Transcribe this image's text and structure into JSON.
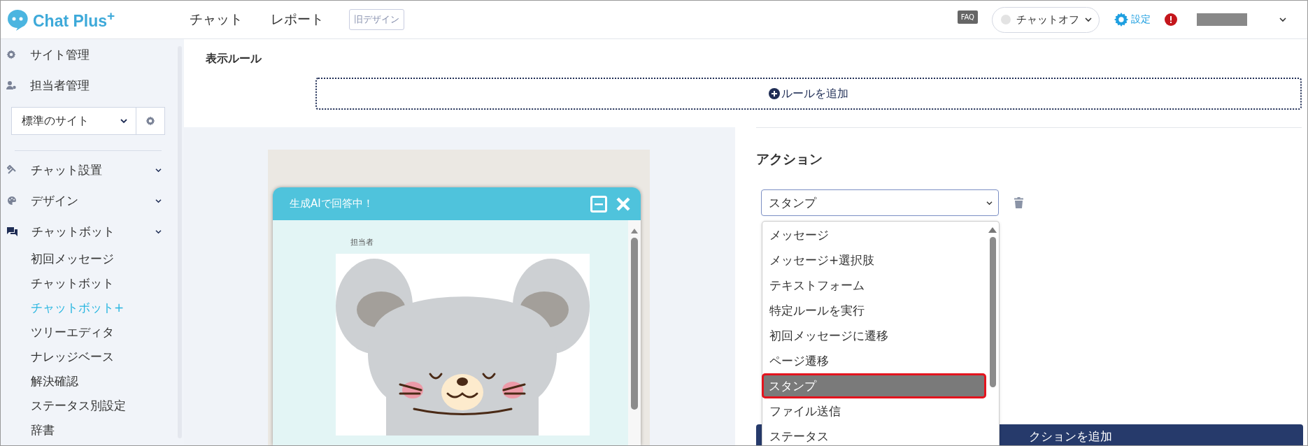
{
  "header": {
    "logo": "Chat Plus$^{+}$",
    "nav": [
      {
        "label": "チャット"
      },
      {
        "label": "レポート"
      }
    ],
    "old_design_button": "旧デザイン",
    "faq_label": "FAQ",
    "chat_status": {
      "label": "チャットオフ",
      "on": false
    },
    "settings": "設定"
  },
  "sidebar": {
    "top_items": [
      {
        "label": "サイト管理",
        "kind": "gear"
      },
      {
        "label": "担当者管理",
        "kind": "person"
      }
    ],
    "site_select": "標準のサイト",
    "sections": [
      {
        "label": "チャット設置",
        "kind": "tools"
      },
      {
        "label": "デザイン",
        "kind": "palette"
      },
      {
        "label": "チャットボット",
        "kind": "chat",
        "children": [
          {
            "label": "初回メッセージ",
            "selected": false
          },
          {
            "label": "チャットボット",
            "selected": false
          },
          {
            "label": "チャットボット+",
            "selected": true
          },
          {
            "label": "ツリーエディタ",
            "selected": false
          },
          {
            "label": "ナレッジベース",
            "selected": false
          },
          {
            "label": "解決確認",
            "selected": false
          },
          {
            "label": "ステータス別設定",
            "selected": false
          },
          {
            "label": "辞書",
            "selected": false
          }
        ]
      }
    ]
  },
  "display_rule": {
    "title": "表示ルール",
    "add_rule": "ルールを追加"
  },
  "preview": {
    "chat_title": "生成AIで回答中！",
    "agent_label": "担当者"
  },
  "action": {
    "title": "アクション",
    "select_value": "スタンプ",
    "add_action": "クションを追加",
    "options": [
      {
        "label": "メッセージ",
        "selected": false
      },
      {
        "label": "メッセージ+選択肢",
        "selected": false
      },
      {
        "label": "テキストフォーム",
        "selected": false
      },
      {
        "label": "特定ルールを実行",
        "selected": false
      },
      {
        "label": "初回メッセージに遷移",
        "selected": false
      },
      {
        "label": "ページ遷移",
        "selected": false
      },
      {
        "label": "スタンプ",
        "selected": true
      },
      {
        "label": "ファイル送信",
        "selected": false
      },
      {
        "label": "ステータス",
        "selected": false
      }
    ]
  }
}
